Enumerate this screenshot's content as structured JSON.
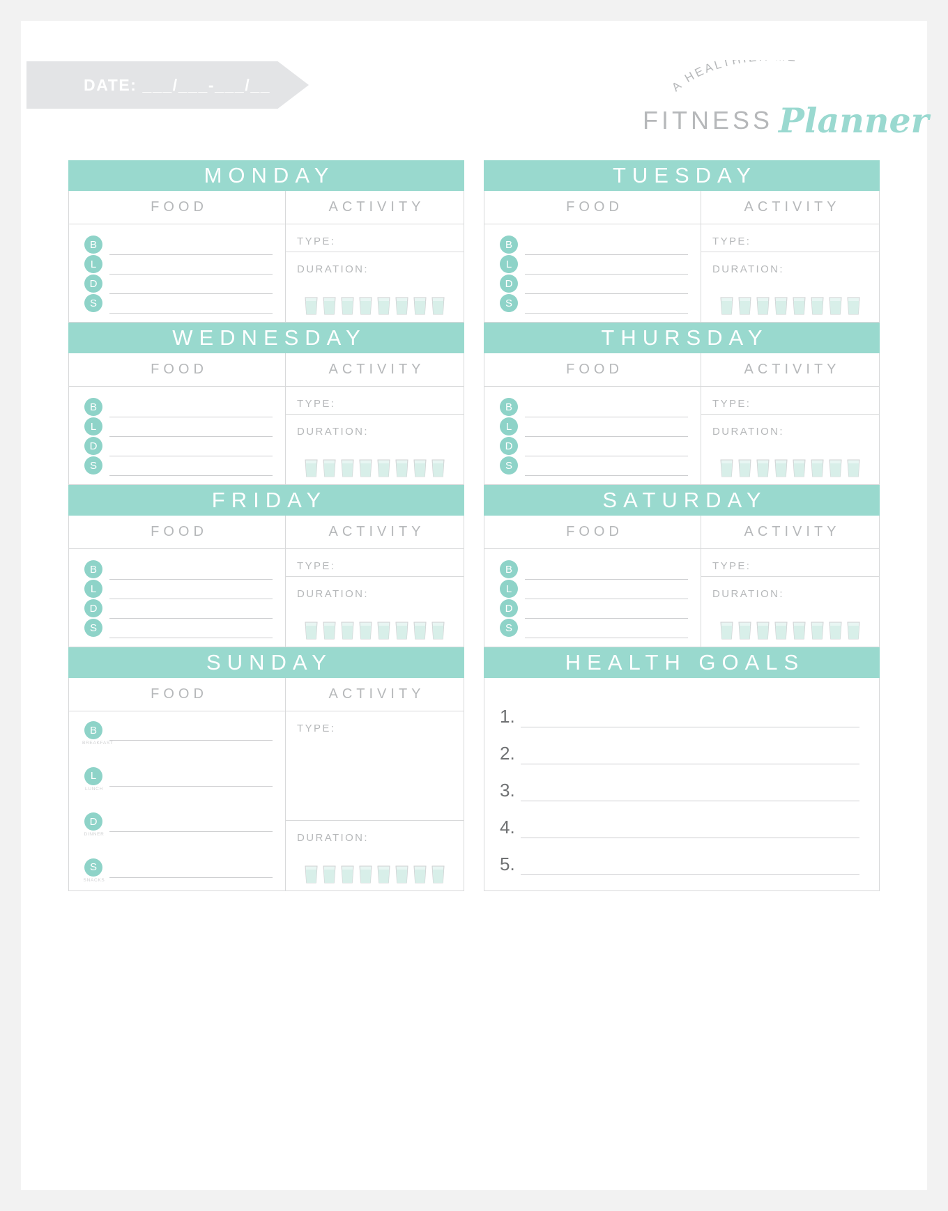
{
  "header": {
    "date_label": "DATE: ___/___-___/__",
    "brand_tagline": "A HEALTHIER ME",
    "brand_word1": "FITNESS",
    "brand_word2": "Planner"
  },
  "colors": {
    "accent": "#99d9ce",
    "badge": "#8ed3c8",
    "text_gray": "#b6b8ba",
    "line_gray": "#cdced0",
    "banner_gray": "#e3e4e6"
  },
  "column_titles": {
    "food": "FOOD",
    "activity": "ACTIVITY"
  },
  "activity_labels": {
    "type": "TYPE:",
    "duration": "DURATION:"
  },
  "meals": [
    {
      "badge": "B",
      "sub": "BREAKFAST"
    },
    {
      "badge": "L",
      "sub": "LUNCH"
    },
    {
      "badge": "D",
      "sub": "DINNER"
    },
    {
      "badge": "S",
      "sub": "SNACKS"
    }
  ],
  "water_glasses_per_day": 8,
  "days": [
    {
      "name": "MONDAY"
    },
    {
      "name": "TUESDAY"
    },
    {
      "name": "WEDNESDAY"
    },
    {
      "name": "THURSDAY"
    },
    {
      "name": "FRIDAY"
    },
    {
      "name": "SATURDAY"
    },
    {
      "name": "SUNDAY"
    }
  ],
  "health_goals": {
    "title": "HEALTH GOALS",
    "items": [
      "1.",
      "2.",
      "3.",
      "4.",
      "5."
    ]
  }
}
